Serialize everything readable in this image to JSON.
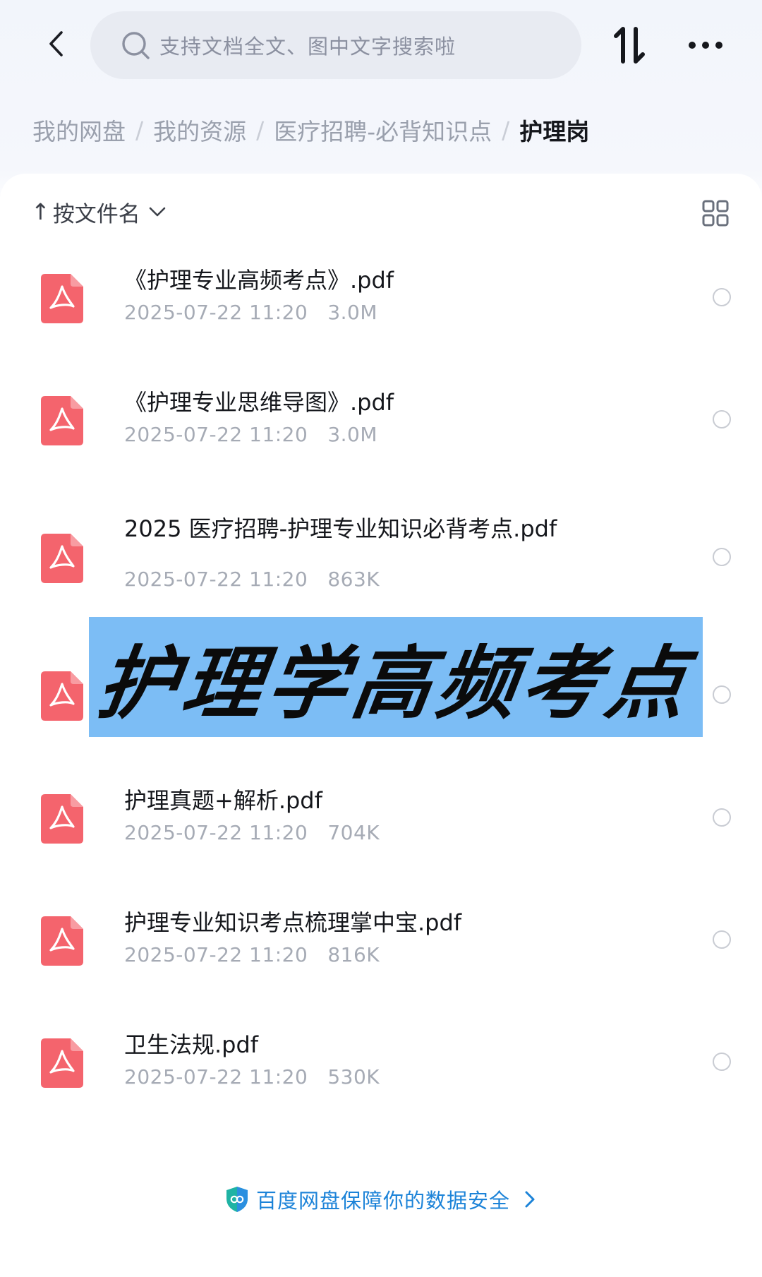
{
  "header": {
    "search_placeholder": "支持文档全文、图中文字搜索啦",
    "back_icon": "chevron-left-icon",
    "sort_icon": "sort-order-icon",
    "more_icon": "more-horizontal-icon"
  },
  "breadcrumb": {
    "items": [
      "我的网盘",
      "我的资源",
      "医疗招聘-必背知识点"
    ],
    "current": "护理岗",
    "separator": "/"
  },
  "sort": {
    "arrow": "↑",
    "label": "按文件名"
  },
  "files": [
    {
      "name": "《护理专业高频考点》.pdf",
      "date": "2025-07-22 11:20",
      "size": "3.0M"
    },
    {
      "name": "《护理专业思维导图》.pdf",
      "date": "2025-07-22 11:20",
      "size": "3.0M"
    },
    {
      "name": "2025 医疗招聘-护理专业知识必背考点.pdf",
      "date": "2025-07-22 11:20",
      "size": "863K"
    },
    {
      "name": "",
      "date": "",
      "size": ""
    },
    {
      "name": "护理真题+解析.pdf",
      "date": "2025-07-22 11:20",
      "size": "704K"
    },
    {
      "name": "护理专业知识考点梳理掌中宝.pdf",
      "date": "2025-07-22 11:20",
      "size": "816K"
    },
    {
      "name": "卫生法规.pdf",
      "date": "2025-07-22 11:20",
      "size": "530K"
    }
  ],
  "overlay": {
    "text": "护理学高频考点"
  },
  "footer": {
    "text": "百度网盘保障你的数据安全"
  },
  "colors": {
    "pdf_red": "#f4646d",
    "overlay_blue": "#7cbdf5",
    "link_blue": "#1c83d8",
    "shield_teal": "#1fb3a4"
  }
}
